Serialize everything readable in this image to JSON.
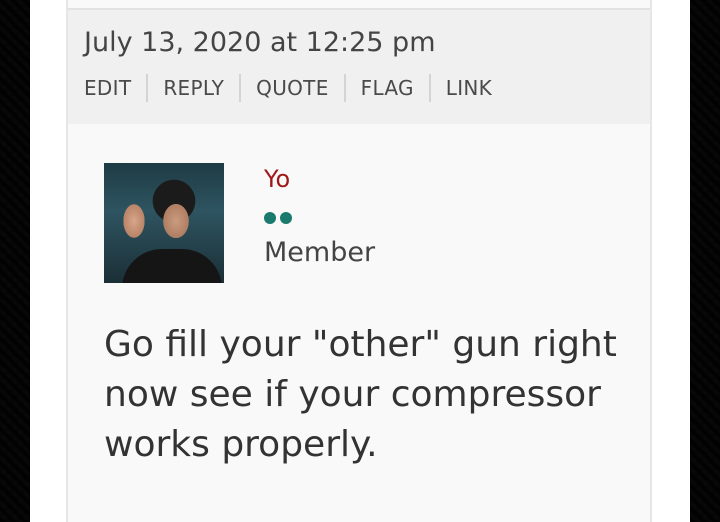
{
  "post": {
    "date": "July 13, 2020 at 12:25 pm",
    "actions": [
      "EDIT",
      "REPLY",
      "QUOTE",
      "FLAG",
      "LINK"
    ],
    "author": {
      "name": "Yo",
      "rank_dots": 2,
      "role": "Member"
    },
    "body": "Go fill your \"other\" gun right now see if your compressor works properly."
  },
  "colors": {
    "author_name": "#a01818",
    "rank_dot": "#1a7a6e",
    "text": "#444444"
  }
}
